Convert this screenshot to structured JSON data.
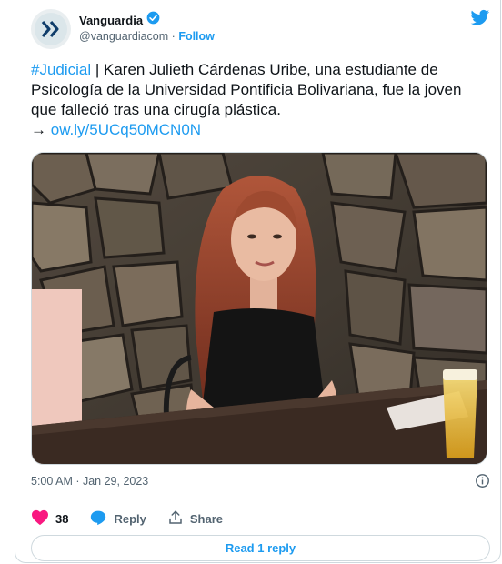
{
  "account": {
    "name": "Vanguardia",
    "handle": "@vanguardiacom",
    "separator": "·",
    "follow_label": "Follow"
  },
  "tweet": {
    "hashtag": "#Judicial",
    "body": " | Karen Julieth Cárdenas Uribe, una estudiante de Psicología de la Universidad Pontificia Bolivariana, fue la joven que falleció tras una cirugía plástica.",
    "arrow": "→ ",
    "link": "ow.ly/5UCq50MCN0N",
    "timestamp": "5:00 AM · Jan 29, 2023"
  },
  "actions": {
    "like_count": "38",
    "reply_label": "Reply",
    "share_label": "Share"
  },
  "read_replies_label": "Read 1 reply",
  "colors": {
    "accent": "#1d9bf0",
    "like": "#f91880",
    "text": "#0f1419",
    "muted": "#536471",
    "border": "#cfd9de"
  },
  "icons": [
    "avatar-logo-icon",
    "verified-badge-icon",
    "twitter-bird-icon",
    "info-icon",
    "heart-icon",
    "reply-bubble-icon",
    "share-icon"
  ]
}
